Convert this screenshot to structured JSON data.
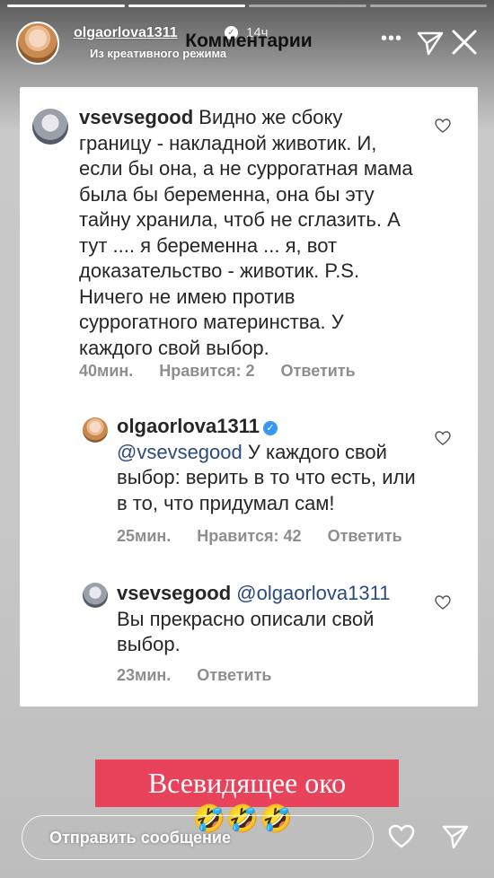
{
  "story": {
    "username": "olgaorlova1311",
    "time": "14ч",
    "subtitle": "Из креативного режима",
    "title": "Комментарии",
    "progress": {
      "total": 4,
      "completed": 2
    }
  },
  "comments": [
    {
      "username": "vsevsegood",
      "text": "Видно же сбоку границу - накладной животик. И, если бы она, а не суррогатная мама была бы беременна, она бы эту тайну хранила, чтоб не сглазить. А тут .... я беременна ... я, вот доказательство - животик. P.S. Ничего не имею против суррогатного материнства. У каждого свой выбор.",
      "time": "40мин.",
      "likes": "Нравится: 2",
      "reply": "Ответить"
    },
    {
      "username": "olgaorlova1311",
      "mention": "@vsevsegood",
      "text": "У каждого свой выбор: верить в то что есть, или в то, что придумал сам!",
      "time": "25мин.",
      "likes": "Нравится: 42",
      "reply": "Ответить"
    },
    {
      "username": "vsevsegood",
      "mention": "@olgaorlova1311",
      "text": "Вы прекрасно описали свой выбор.",
      "time": "23мин.",
      "reply": "Ответить"
    }
  ],
  "caption": "Всевидящее око",
  "emojis": "🤣🤣🤣",
  "message": {
    "placeholder": "Отправить сообщение"
  },
  "icons": {
    "more": "more-icon",
    "send": "send-icon",
    "close": "close-icon",
    "heart": "heart-icon"
  },
  "colors": {
    "caption_bg": "#e8435b",
    "verified": "#3897f0",
    "mention": "#2b4b7d"
  }
}
